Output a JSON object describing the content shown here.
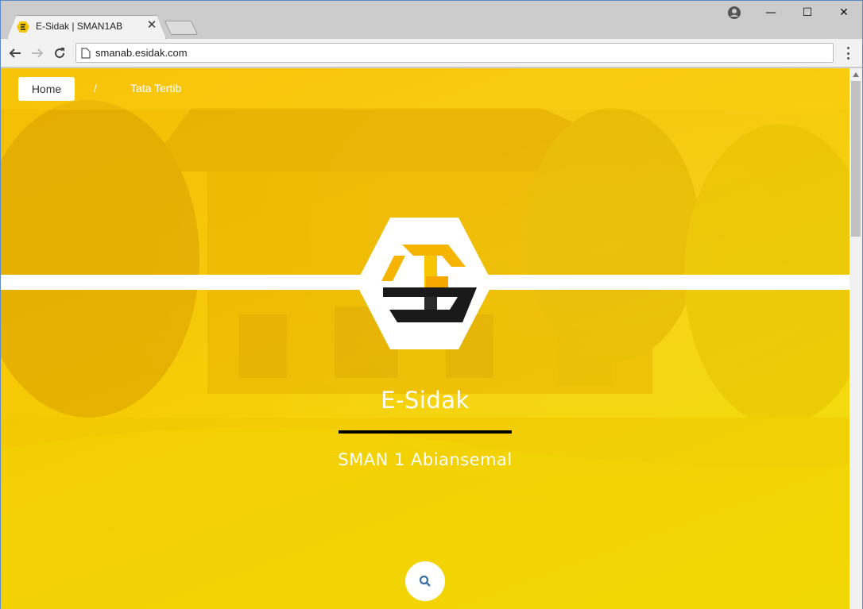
{
  "browser": {
    "tab_title": "E-Sidak | SMAN1AB",
    "tab_close": "✕",
    "url": "smanab.esidak.com",
    "window_controls": {
      "minimize": "—",
      "maximize": "☐",
      "close": "✕"
    }
  },
  "site": {
    "nav": {
      "home": "Home",
      "separator": "/",
      "link": "Tata Tertib"
    },
    "brand_title": "E-Sidak",
    "brand_subtitle": "SMAN 1 Abiansemal"
  },
  "colors": {
    "accent": "#f6c705",
    "dark": "#1a1a1a",
    "white": "#ffffff"
  },
  "icons": [
    "favicon-icon",
    "account-icon",
    "back-arrow-icon",
    "forward-arrow-icon",
    "reload-icon",
    "page-icon",
    "menu-dots-icon",
    "logo-icon",
    "search-icon",
    "scroll-up-icon"
  ]
}
